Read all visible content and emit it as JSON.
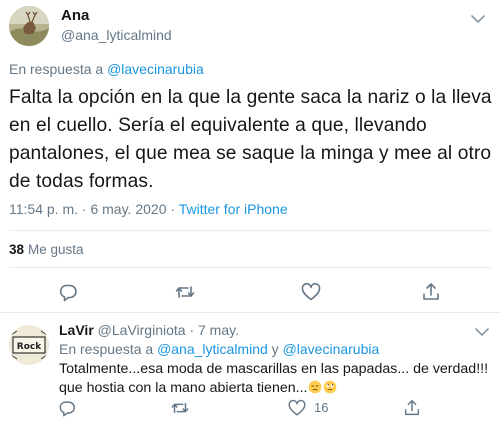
{
  "main_tweet": {
    "author_name": "Ana",
    "author_handle": "@ana_lyticalmind",
    "reply_prefix": "En respuesta a ",
    "reply_to": "@lavecinarubia",
    "text": "Falta la opción en la que la gente saca la nariz o la lleva en el cuello. Sería el equivalente a que, llevando pantalones, el que mea se saque la minga y mee al otro de todas formas.",
    "time": "11:54 p. m.",
    "separator": " · ",
    "date": "6 may. 2020",
    "source": "Twitter for iPhone",
    "likes_count": "38",
    "likes_label": "Me gusta"
  },
  "reply_tweet": {
    "author_name": "LaVir",
    "author_handle": "@LaVirginiota",
    "date": "· 7 may.",
    "reply_prefix": "En respuesta a ",
    "reply_to_1": "@ana_lyticalmind",
    "reply_conj": " y ",
    "reply_to_2": "@lavecinarubia",
    "text": "Totalmente...esa moda de mascarillas en las papadas... de verdad!!! que hostia con la mano abierta tienen...",
    "like_count": "16",
    "avatar_text": "Rock"
  },
  "icons": {
    "chevron": "chevron-down-icon",
    "reply": "reply-icon",
    "retweet": "retweet-icon",
    "like": "heart-icon",
    "share": "share-icon",
    "emoji_1": "disappointed-face-emoji",
    "emoji_2": "eye-roll-face-emoji"
  },
  "colors": {
    "link": "#1b95e0",
    "muted": "#657786",
    "text": "#14171a",
    "divider": "#e6ecf0"
  }
}
